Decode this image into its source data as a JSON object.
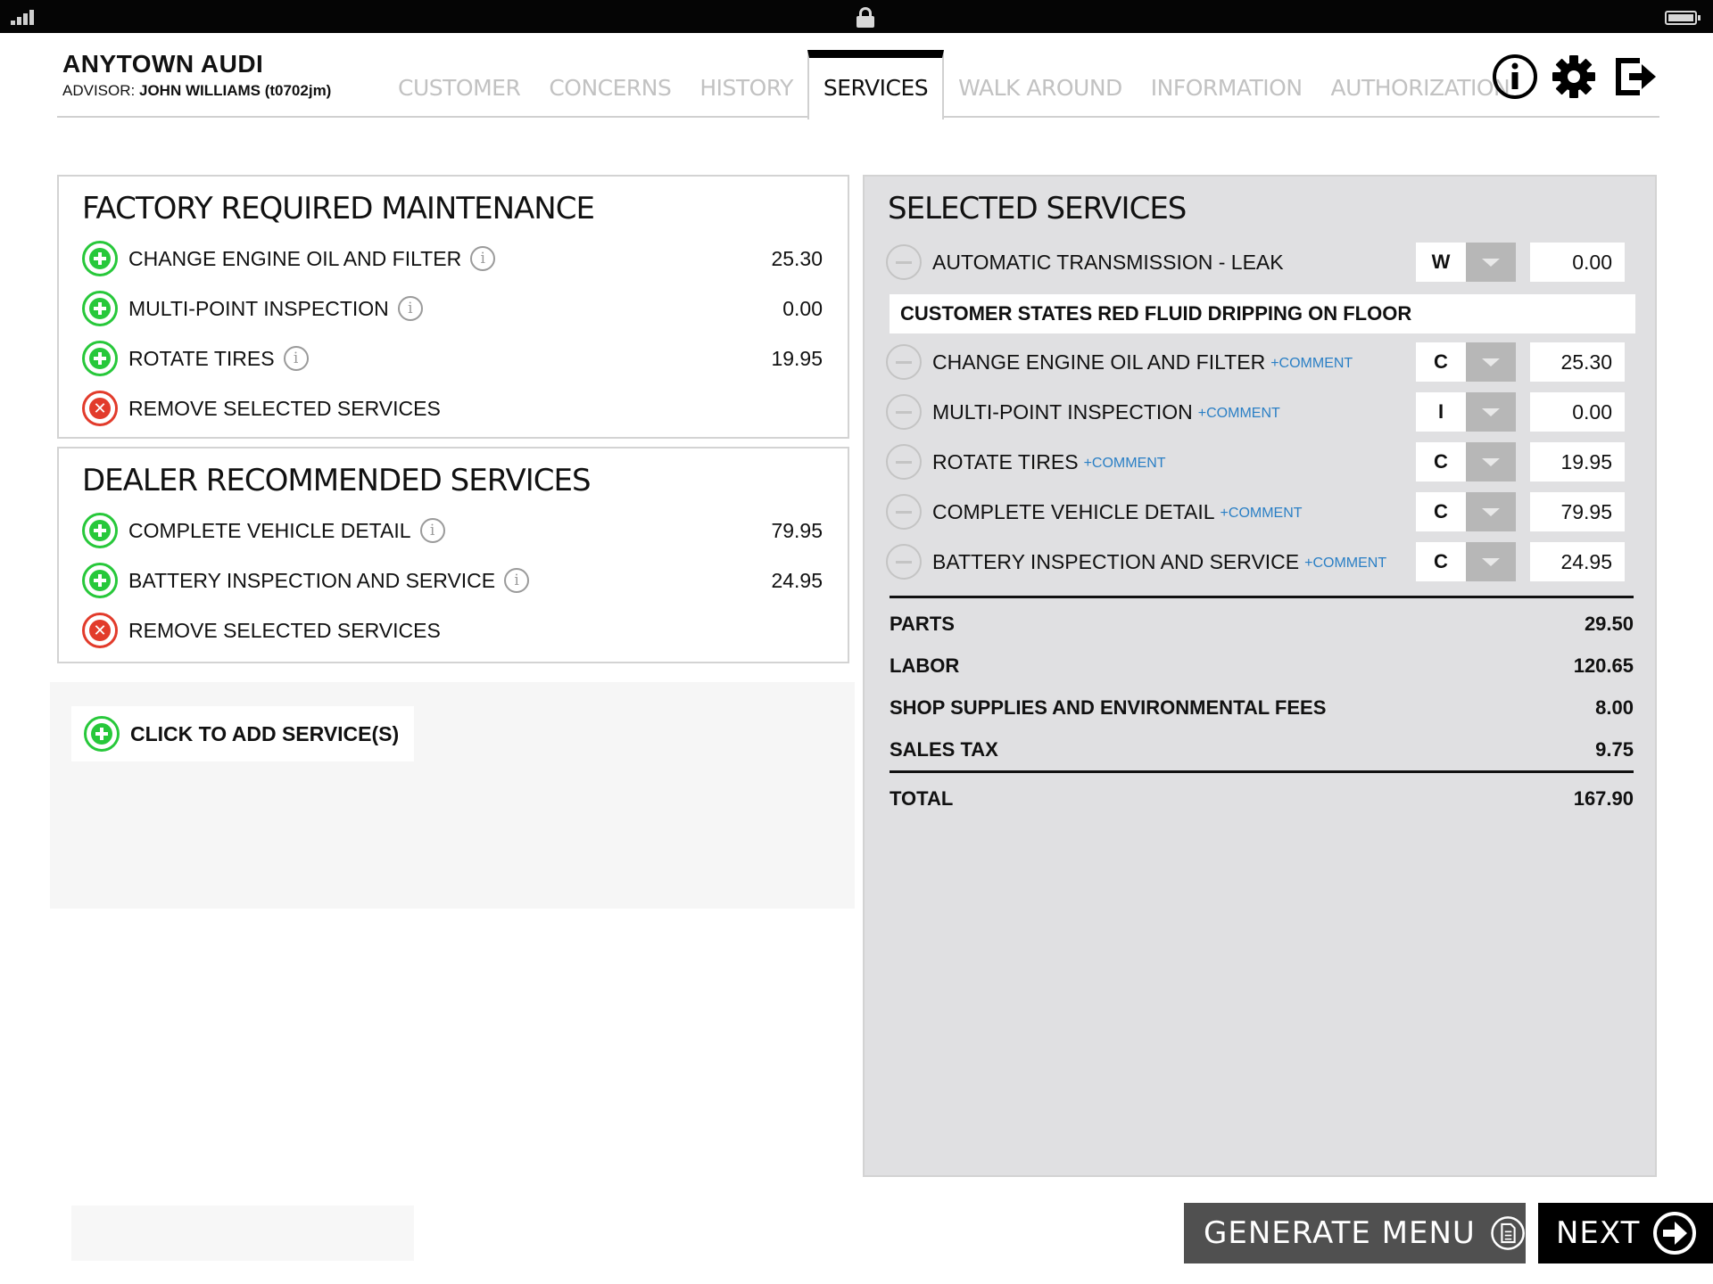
{
  "header": {
    "dealer_name": "ANYTOWN AUDI",
    "advisor_prefix": "ADVISOR:",
    "advisor_name": "JOHN WILLIAMS (t0702jm)"
  },
  "tabs": [
    {
      "label": "CUSTOMER"
    },
    {
      "label": "CONCERNS"
    },
    {
      "label": "HISTORY"
    },
    {
      "label": "SERVICES"
    },
    {
      "label": "WALK AROUND"
    },
    {
      "label": "INFORMATION"
    },
    {
      "label": "AUTHORIZATION"
    }
  ],
  "active_tab": "SERVICES",
  "header_icons": [
    "info-icon",
    "gear-icon",
    "logout-icon"
  ],
  "factory": {
    "title": "FACTORY REQUIRED MAINTENANCE",
    "items": [
      {
        "label": "CHANGE ENGINE OIL AND FILTER",
        "price": "25.30"
      },
      {
        "label": "MULTI-POINT INSPECTION",
        "price": "0.00"
      },
      {
        "label": "ROTATE TIRES",
        "price": "19.95"
      }
    ],
    "remove_label": "REMOVE SELECTED SERVICES"
  },
  "dealer": {
    "title": "DEALER RECOMMENDED SERVICES",
    "items": [
      {
        "label": "COMPLETE VEHICLE DETAIL",
        "price": "79.95"
      },
      {
        "label": "BATTERY INSPECTION AND SERVICE",
        "price": "24.95"
      }
    ],
    "remove_label": "REMOVE SELECTED SERVICES"
  },
  "add_service_label": "CLICK TO ADD SERVICE(S)",
  "selected": {
    "title": "SELECTED SERVICES",
    "concern": {
      "label": "AUTOMATIC TRANSMISSION - LEAK",
      "code": "W",
      "price": "0.00",
      "note": "CUSTOMER STATES RED FLUID DRIPPING ON FLOOR"
    },
    "items": [
      {
        "label": "CHANGE ENGINE OIL AND FILTER",
        "comment": "+COMMENT",
        "code": "C",
        "price": "25.30"
      },
      {
        "label": "MULTI-POINT INSPECTION",
        "comment": "+COMMENT",
        "code": "I",
        "price": "0.00"
      },
      {
        "label": "ROTATE TIRES",
        "comment": "+COMMENT",
        "code": "C",
        "price": "19.95"
      },
      {
        "label": "COMPLETE VEHICLE DETAIL",
        "comment": "+COMMENT",
        "code": "C",
        "price": "79.95"
      },
      {
        "label": "BATTERY INSPECTION AND SERVICE",
        "comment": "+COMMENT",
        "code": "C",
        "price": "24.95"
      }
    ],
    "totals": [
      {
        "label": "PARTS",
        "value": "29.50"
      },
      {
        "label": "LABOR",
        "value": "120.65"
      },
      {
        "label": "SHOP SUPPLIES AND ENVIRONMENTAL FEES",
        "value": "8.00"
      },
      {
        "label": "SALES TAX",
        "value": "9.75"
      }
    ],
    "total": {
      "label": "TOTAL",
      "value": "167.90"
    }
  },
  "footer": {
    "generate_label": "GENERATE MENU",
    "next_label": "NEXT"
  },
  "colors": {
    "add_green": "#27c83a",
    "remove_red": "#e23b2b",
    "comment_blue": "#2a7fc5",
    "selected_panel_bg": "#e0e0e2"
  }
}
